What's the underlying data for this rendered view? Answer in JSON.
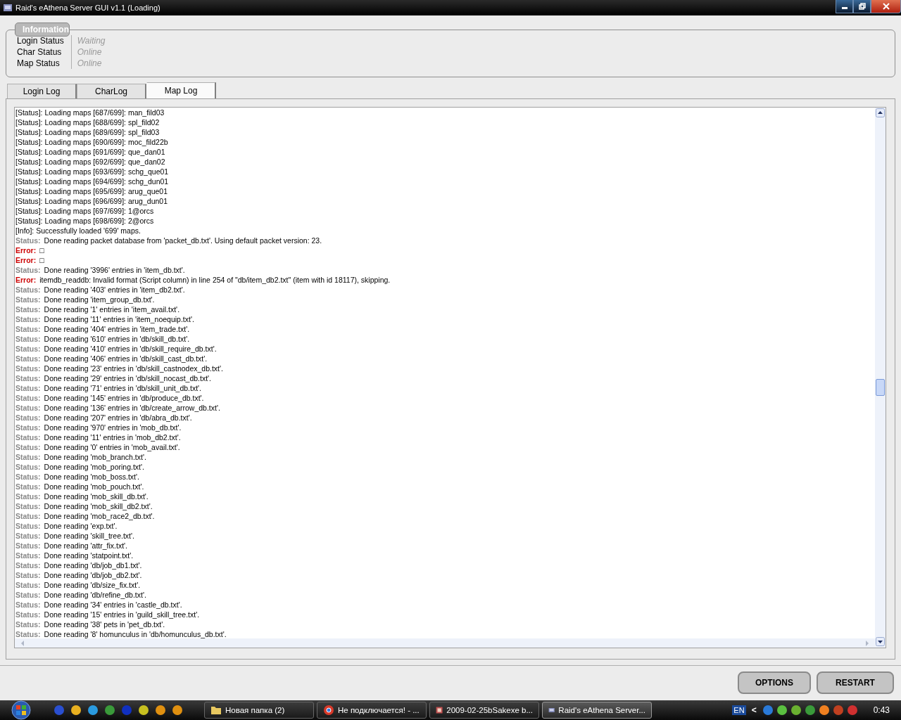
{
  "window": {
    "title": "Raid's eAthena Server GUI v1.1 (Loading)"
  },
  "information": {
    "legend": "Information",
    "rows": [
      {
        "label": "Login Status",
        "value": "Waiting"
      },
      {
        "label": "Char Status",
        "value": "Online"
      },
      {
        "label": "Map Status",
        "value": "Online"
      }
    ]
  },
  "tabs": [
    {
      "label": "Login Log",
      "selected": false
    },
    {
      "label": "CharLog",
      "selected": false
    },
    {
      "label": "Map Log",
      "selected": true
    }
  ],
  "log": [
    {
      "kind": "plain",
      "text": "[Status]: Loading maps [687/699]: man_fild03"
    },
    {
      "kind": "plain",
      "text": "[Status]: Loading maps [688/699]: spl_fild02"
    },
    {
      "kind": "plain",
      "text": "[Status]: Loading maps [689/699]: spl_fild03"
    },
    {
      "kind": "plain",
      "text": "[Status]: Loading maps [690/699]: moc_fild22b"
    },
    {
      "kind": "plain",
      "text": "[Status]: Loading maps [691/699]: que_dan01"
    },
    {
      "kind": "plain",
      "text": "[Status]: Loading maps [692/699]: que_dan02"
    },
    {
      "kind": "plain",
      "text": "[Status]: Loading maps [693/699]: schg_que01"
    },
    {
      "kind": "plain",
      "text": "[Status]: Loading maps [694/699]: schg_dun01"
    },
    {
      "kind": "plain",
      "text": "[Status]: Loading maps [695/699]: arug_que01"
    },
    {
      "kind": "plain",
      "text": "[Status]: Loading maps [696/699]: arug_dun01"
    },
    {
      "kind": "plain",
      "text": "[Status]: Loading maps [697/699]: 1@orcs"
    },
    {
      "kind": "plain",
      "text": "[Status]: Loading maps [698/699]: 2@orcs"
    },
    {
      "kind": "plain",
      "text": "[Info]: Successfully loaded '699' maps."
    },
    {
      "kind": "status",
      "tag": "Status:",
      "text": "Done reading packet database from 'packet_db.txt'. Using default packet version: 23."
    },
    {
      "kind": "error",
      "tag": "Error:",
      "text": "□"
    },
    {
      "kind": "error",
      "tag": "Error:",
      "text": "□"
    },
    {
      "kind": "status",
      "tag": "Status:",
      "text": "Done reading '3996' entries in 'item_db.txt'."
    },
    {
      "kind": "error",
      "tag": "Error:",
      "text": "itemdb_readdb: Invalid format (Script column) in line 254 of \"db/item_db2.txt\" (item with id 18117), skipping."
    },
    {
      "kind": "status",
      "tag": "Status:",
      "text": "Done reading '403' entries in 'item_db2.txt'."
    },
    {
      "kind": "status",
      "tag": "Status:",
      "text": "Done reading 'item_group_db.txt'."
    },
    {
      "kind": "status",
      "tag": "Status:",
      "text": "Done reading '1' entries in 'item_avail.txt'."
    },
    {
      "kind": "status",
      "tag": "Status:",
      "text": "Done reading '11' entries in 'item_noequip.txt'."
    },
    {
      "kind": "status",
      "tag": "Status:",
      "text": "Done reading '404' entries in 'item_trade.txt'."
    },
    {
      "kind": "status",
      "tag": "Status:",
      "text": "Done reading '610' entries in 'db/skill_db.txt'."
    },
    {
      "kind": "status",
      "tag": "Status:",
      "text": "Done reading '410' entries in 'db/skill_require_db.txt'."
    },
    {
      "kind": "status",
      "tag": "Status:",
      "text": "Done reading '406' entries in 'db/skill_cast_db.txt'."
    },
    {
      "kind": "status",
      "tag": "Status:",
      "text": "Done reading '23' entries in 'db/skill_castnodex_db.txt'."
    },
    {
      "kind": "status",
      "tag": "Status:",
      "text": "Done reading '29' entries in 'db/skill_nocast_db.txt'."
    },
    {
      "kind": "status",
      "tag": "Status:",
      "text": "Done reading '71' entries in 'db/skill_unit_db.txt'."
    },
    {
      "kind": "status",
      "tag": "Status:",
      "text": "Done reading '145' entries in 'db/produce_db.txt'."
    },
    {
      "kind": "status",
      "tag": "Status:",
      "text": "Done reading '136' entries in 'db/create_arrow_db.txt'."
    },
    {
      "kind": "status",
      "tag": "Status:",
      "text": "Done reading '207' entries in 'db/abra_db.txt'."
    },
    {
      "kind": "status",
      "tag": "Status:",
      "text": "Done reading '970' entries in 'mob_db.txt'."
    },
    {
      "kind": "status",
      "tag": "Status:",
      "text": "Done reading '11' entries in 'mob_db2.txt'."
    },
    {
      "kind": "status",
      "tag": "Status:",
      "text": "Done reading '0' entries in 'mob_avail.txt'."
    },
    {
      "kind": "status",
      "tag": "Status:",
      "text": "Done reading 'mob_branch.txt'."
    },
    {
      "kind": "status",
      "tag": "Status:",
      "text": "Done reading 'mob_poring.txt'."
    },
    {
      "kind": "status",
      "tag": "Status:",
      "text": "Done reading 'mob_boss.txt'."
    },
    {
      "kind": "status",
      "tag": "Status:",
      "text": "Done reading 'mob_pouch.txt'."
    },
    {
      "kind": "status",
      "tag": "Status:",
      "text": "Done reading 'mob_skill_db.txt'."
    },
    {
      "kind": "status",
      "tag": "Status:",
      "text": "Done reading 'mob_skill_db2.txt'."
    },
    {
      "kind": "status",
      "tag": "Status:",
      "text": "Done reading 'mob_race2_db.txt'."
    },
    {
      "kind": "status",
      "tag": "Status:",
      "text": "Done reading 'exp.txt'."
    },
    {
      "kind": "status",
      "tag": "Status:",
      "text": "Done reading 'skill_tree.txt'."
    },
    {
      "kind": "status",
      "tag": "Status:",
      "text": "Done reading 'attr_fix.txt'."
    },
    {
      "kind": "status",
      "tag": "Status:",
      "text": "Done reading 'statpoint.txt'."
    },
    {
      "kind": "status",
      "tag": "Status:",
      "text": "Done reading 'db/job_db1.txt'."
    },
    {
      "kind": "status",
      "tag": "Status:",
      "text": "Done reading 'db/job_db2.txt'."
    },
    {
      "kind": "status",
      "tag": "Status:",
      "text": "Done reading 'db/size_fix.txt'."
    },
    {
      "kind": "status",
      "tag": "Status:",
      "text": "Done reading 'db/refine_db.txt'."
    },
    {
      "kind": "status",
      "tag": "Status:",
      "text": "Done reading '34' entries in 'castle_db.txt'."
    },
    {
      "kind": "status",
      "tag": "Status:",
      "text": "Done reading '15' entries in 'guild_skill_tree.txt'."
    },
    {
      "kind": "status",
      "tag": "Status:",
      "text": "Done reading '38' pets in 'pet_db.txt'."
    },
    {
      "kind": "status",
      "tag": "Status:",
      "text": "Done reading '8' homunculus in 'db/homunculus_db.txt'."
    }
  ],
  "buttons": [
    "OPTIONS",
    "RESTART"
  ],
  "taskbar": {
    "tasks": [
      {
        "kind": "folder",
        "label": "Новая папка (2)",
        "selected": false
      },
      {
        "kind": "browser",
        "label": "Не подключается! - ...",
        "selected": false
      },
      {
        "kind": "image",
        "label": "2009-02-25bSakexe b...",
        "selected": false
      },
      {
        "kind": "app",
        "label": "Raid's eAthena Server...",
        "selected": true
      }
    ],
    "language": "EN",
    "tray_toggle": "<",
    "clock": "0:43"
  }
}
